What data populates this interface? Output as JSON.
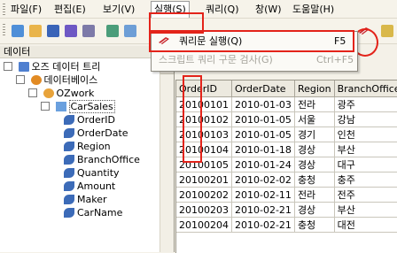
{
  "menu": {
    "items": [
      "파일(F)",
      "편집(E)",
      "보기(V)",
      "실행(S)",
      "쿼리(Q)",
      "창(W)",
      "도움말(H)"
    ]
  },
  "dropdown": {
    "items": [
      {
        "label": "쿼리문 실행(Q)",
        "shortcut": "F5",
        "enabled": true
      },
      {
        "label": "스크립트 쿼리 구문 검사(G)",
        "shortcut": "Ctrl+F5",
        "enabled": false
      }
    ]
  },
  "sidepanel": {
    "title": "데이터",
    "pin": "ᵩ",
    "tree": [
      {
        "label": "오즈 데이터 트리",
        "icon": "data-tree-icon"
      },
      {
        "label": "데이터베이스",
        "icon": "database-icon"
      },
      {
        "label": "OZwork",
        "icon": "dataset-icon"
      },
      {
        "label": "CarSales",
        "icon": "table-icon"
      },
      {
        "label": "OrderID",
        "icon": "field-icon"
      },
      {
        "label": "OrderDate",
        "icon": "field-icon"
      },
      {
        "label": "Region",
        "icon": "field-icon"
      },
      {
        "label": "BranchOffice",
        "icon": "field-icon"
      },
      {
        "label": "Quantity",
        "icon": "field-icon"
      },
      {
        "label": "Amount",
        "icon": "field-icon"
      },
      {
        "label": "Maker",
        "icon": "field-icon"
      },
      {
        "label": "CarName",
        "icon": "field-icon"
      }
    ]
  },
  "grid": {
    "columns": [
      "OrderID",
      "OrderDate",
      "Region",
      "BranchOffice"
    ],
    "rows": [
      [
        "20100101",
        "2010-01-03",
        "전라",
        "광주"
      ],
      [
        "20100102",
        "2010-01-05",
        "서울",
        "강남"
      ],
      [
        "20100103",
        "2010-01-05",
        "경기",
        "인천"
      ],
      [
        "20100104",
        "2010-01-18",
        "경상",
        "부산"
      ],
      [
        "20100105",
        "2010-01-24",
        "경상",
        "대구"
      ],
      [
        "20100201",
        "2010-02-02",
        "충청",
        "충주"
      ],
      [
        "20100202",
        "2010-02-11",
        "전라",
        "전주"
      ],
      [
        "20100203",
        "2010-02-21",
        "경상",
        "부산"
      ],
      [
        "20100204",
        "2010-02-21",
        "충청",
        "대전"
      ]
    ]
  },
  "colors": {
    "highlight": "#e3231a",
    "menu_bg": "#f6f3ea"
  }
}
